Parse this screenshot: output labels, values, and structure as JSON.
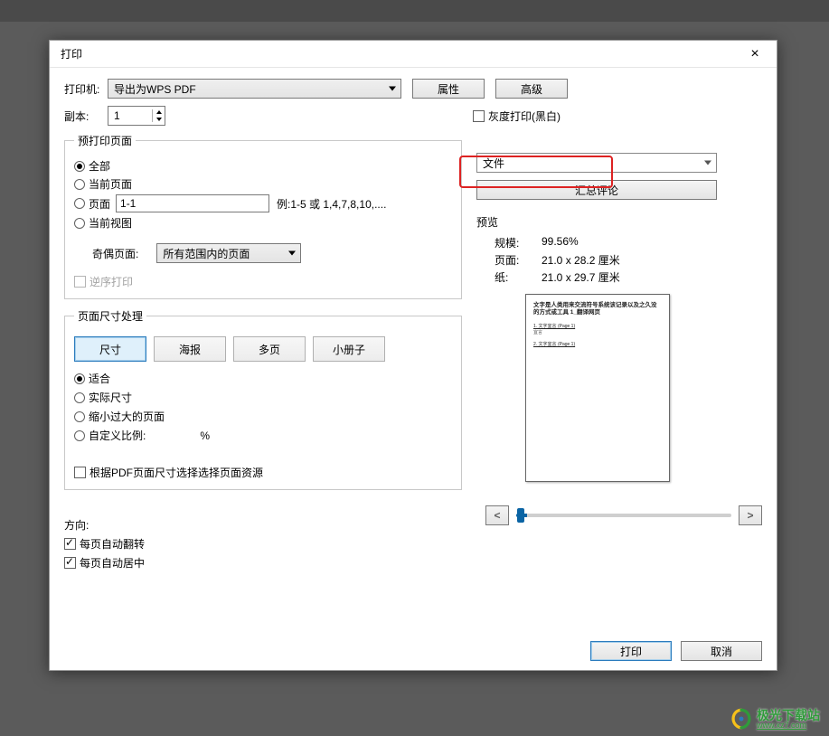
{
  "dialog": {
    "title": "打印",
    "close_icon": "×",
    "printer": {
      "label": "打印机:",
      "selected": "导出为WPS PDF",
      "properties_btn": "属性",
      "advanced_btn": "高级"
    },
    "copies": {
      "label": "副本:",
      "value": "1"
    },
    "grayscale": {
      "label": "灰度打印(黑白)",
      "checked": false
    },
    "range_group": {
      "legend": "预打印页面",
      "all": "全部",
      "current": "当前页面",
      "pages": "页面",
      "pages_value": "1-1",
      "pages_hint": "例:1-5 或 1,4,7,8,10,....",
      "current_view": "当前视图",
      "selected": "all",
      "odd_even_label": "奇偶页面:",
      "odd_even_value": "所有范围内的页面",
      "reverse": "逆序打印"
    },
    "sizing_group": {
      "legend": "页面尺寸处理",
      "tabs": {
        "size": "尺寸",
        "poster": "海报",
        "multi": "多页",
        "booklet": "小册子",
        "active": "size"
      },
      "fit": "适合",
      "actual": "实际尺寸",
      "shrink": "缩小过大的页面",
      "custom": "自定义比例:",
      "custom_value": "",
      "percent": "%",
      "selected": "fit",
      "pdf_sel": "根据PDF页面尺寸选择选择页面资源"
    },
    "orientation": {
      "label": "方向:",
      "auto_rotate": "每页自动翻转",
      "auto_center": "每页自动居中"
    },
    "right": {
      "doc_select": "文件",
      "summary_btn": "汇总评论",
      "preview_label": "预览",
      "scale_k": "规模:",
      "scale_v": "99.56%",
      "page_k": "页面:",
      "page_v": "21.0 x 28.2 厘米",
      "paper_k": "纸:",
      "paper_v": "21.0 x 29.7 厘米",
      "nav_prev": "<",
      "nav_next": ">"
    },
    "preview_doc": {
      "title": "文字是人类用来交流符号系统该记录以及之久没的方式或工具 1_翻译网页",
      "h1": "1. 文字宜言 (Page 1)",
      "t1": "宜言",
      "h2": "2. 文字宜言 (Page 1)"
    },
    "footer": {
      "print_btn": "打印",
      "cancel_btn": "取消"
    }
  },
  "watermark": {
    "name": "极光下载站",
    "url": "www.xz7.com"
  }
}
